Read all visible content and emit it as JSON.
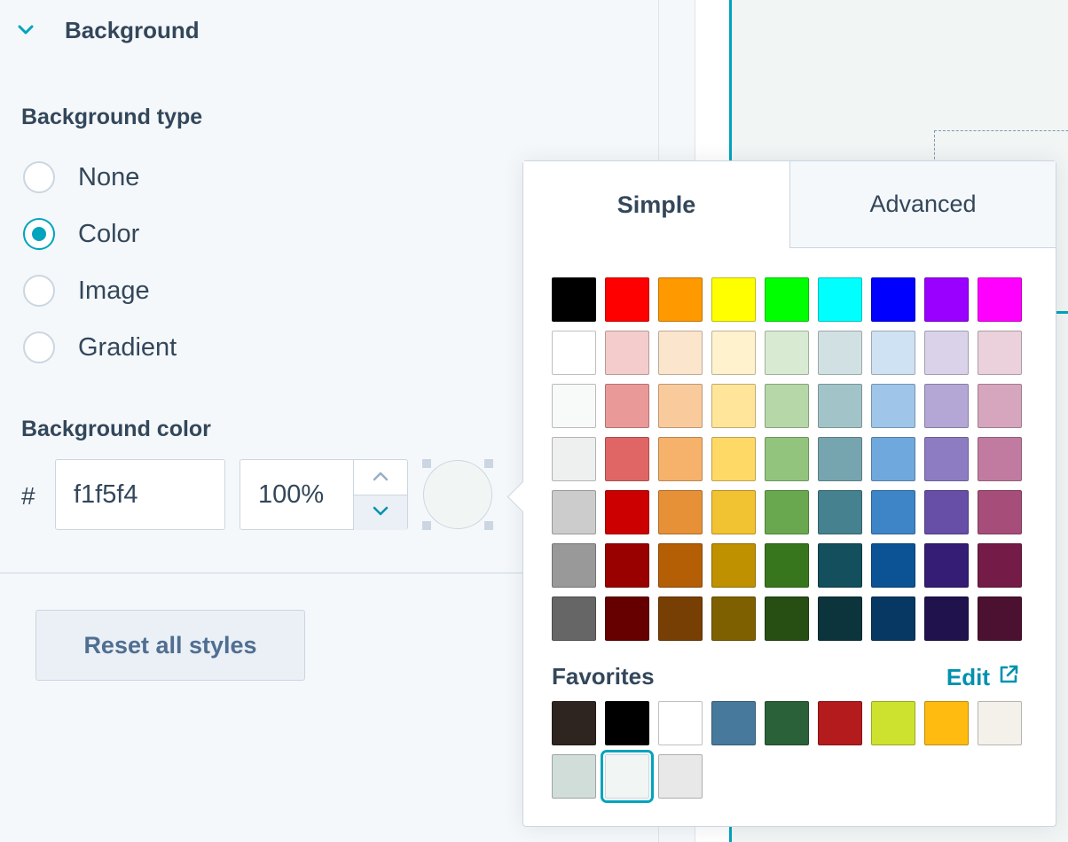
{
  "sidebar": {
    "section_title": "Background",
    "background_type_label": "Background type",
    "types": [
      {
        "label": "None",
        "checked": false
      },
      {
        "label": "Color",
        "checked": true
      },
      {
        "label": "Image",
        "checked": false
      },
      {
        "label": "Gradient",
        "checked": false
      }
    ],
    "background_color_label": "Background color",
    "hash_symbol": "#",
    "hex_value": "f1f5f4",
    "opacity_value": "100%",
    "preview_color": "#f1f5f4",
    "reset_label": "Reset all styles"
  },
  "picker": {
    "tab_simple": "Simple",
    "tab_advanced": "Advanced",
    "palette": [
      [
        "#000000",
        "#ff0000",
        "#ff9900",
        "#ffff00",
        "#00ff00",
        "#00ffff",
        "#0000ff",
        "#9900ff",
        "#ff00ff"
      ],
      [
        "#ffffff",
        "#f4cccc",
        "#fce5cd",
        "#fff2cc",
        "#d9ead3",
        "#d0e0e3",
        "#cfe2f3",
        "#d9d2e9",
        "#ead1dc"
      ],
      [
        "#f8f9f9",
        "#ea9999",
        "#f9cb9c",
        "#ffe599",
        "#b6d7a8",
        "#a2c4c9",
        "#9fc5e8",
        "#b4a7d6",
        "#d5a6bd"
      ],
      [
        "#eef0ef",
        "#e06666",
        "#f6b26b",
        "#ffd966",
        "#93c47d",
        "#76a5af",
        "#6fa8dc",
        "#8e7cc3",
        "#c27ba0"
      ],
      [
        "#cccccc",
        "#cc0000",
        "#e69138",
        "#f1c232",
        "#6aa84f",
        "#45818e",
        "#3d85c6",
        "#674ea7",
        "#a64d79"
      ],
      [
        "#999999",
        "#990000",
        "#b45f06",
        "#bf9000",
        "#38761d",
        "#134f5c",
        "#0b5394",
        "#351c75",
        "#741b47"
      ],
      [
        "#666666",
        "#660000",
        "#783f04",
        "#7f6000",
        "#274e13",
        "#0c343d",
        "#073763",
        "#20124d",
        "#4c1130"
      ]
    ],
    "favorites_label": "Favorites",
    "edit_label": "Edit",
    "favorites": [
      "#2e2521",
      "#000000",
      "#ffffff",
      "#47799c",
      "#2a6139",
      "#b31b1d",
      "#cde22e",
      "#ffbb0f",
      "#f4f1eb",
      "#d1ddd9",
      "#f1f5f4",
      "#e8e8e8"
    ],
    "selected_favorite": 10
  },
  "colors": {
    "accent": "#00a4bd",
    "link": "#0091ae",
    "text": "#33475b"
  }
}
